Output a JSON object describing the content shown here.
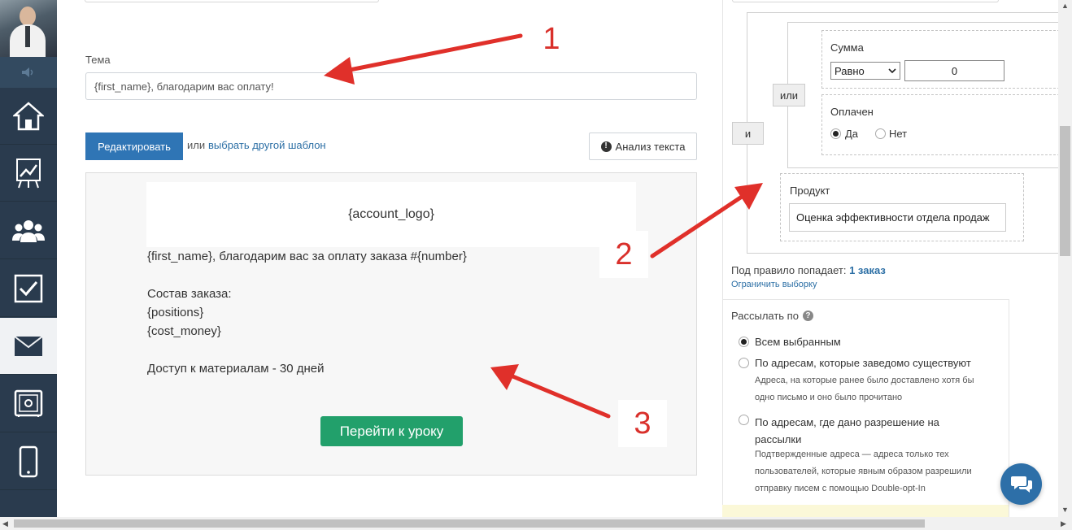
{
  "sidebar": {
    "items": [
      {
        "name": "home",
        "icon": "home-icon"
      },
      {
        "name": "stats",
        "icon": "chart-board-icon"
      },
      {
        "name": "users",
        "icon": "users-icon"
      },
      {
        "name": "tasks",
        "icon": "checkbox-icon"
      },
      {
        "name": "mail",
        "icon": "envelope-icon",
        "active": true
      },
      {
        "name": "safe",
        "icon": "safe-icon"
      },
      {
        "name": "mobile",
        "icon": "phone-icon"
      }
    ]
  },
  "form": {
    "subject_label": "Тема",
    "subject_value": "{first_name}, благодарим вас оплату!",
    "edit_button": "Редактировать",
    "or_text": "или",
    "template_link": "выбрать другой шаблон",
    "analysis_button": "Анализ текста"
  },
  "preview": {
    "logo_placeholder": "{account_logo}",
    "greeting": "{first_name}, благодарим вас за оплату заказа #{number}",
    "order_title": "Состав заказа:",
    "positions": "{positions}",
    "cost": "{cost_money}",
    "access": "Доступ к материалам - 30 дней",
    "lesson_button": "Перейти к уроку"
  },
  "rules": {
    "and_button": "и",
    "or_button": "или",
    "sum_label": "Сумма",
    "sum_operator": "Равно",
    "sum_value": "0",
    "paid_label": "Оплачен",
    "paid_yes": "Да",
    "paid_no": "Нет",
    "paid_selected": "Да",
    "product_label": "Продукт",
    "product_value": "Оценка эффективности отдела продаж",
    "rule_count_prefix": "Под правило попадает:",
    "rule_count_value": "1 заказ",
    "limit_link": "Ограничить выборку"
  },
  "send": {
    "label": "Рассылать по",
    "options": [
      {
        "label": "Всем выбранным",
        "selected": true,
        "desc": ""
      },
      {
        "label": "По адресам, которые заведомо существуют",
        "selected": false,
        "desc": "Адреса, на которые ранее было доставлено хотя бы одно письмо и оно было прочитано"
      },
      {
        "label": "По адресам, где дано разрешение на рассылки",
        "selected": false,
        "desc": "Подтвержденные адреса — адреса только тех пользователей, которые явным образом разрешили отправку писем с помощью Double-opt-In"
      }
    ]
  },
  "annotations": {
    "n1": "1",
    "n2": "2",
    "n3": "3",
    "color": "#e0302a"
  },
  "colors": {
    "sidebar": "#2a3b4e",
    "primary": "#2f75b5",
    "success": "#22a06b",
    "link": "#2c6fa5"
  }
}
